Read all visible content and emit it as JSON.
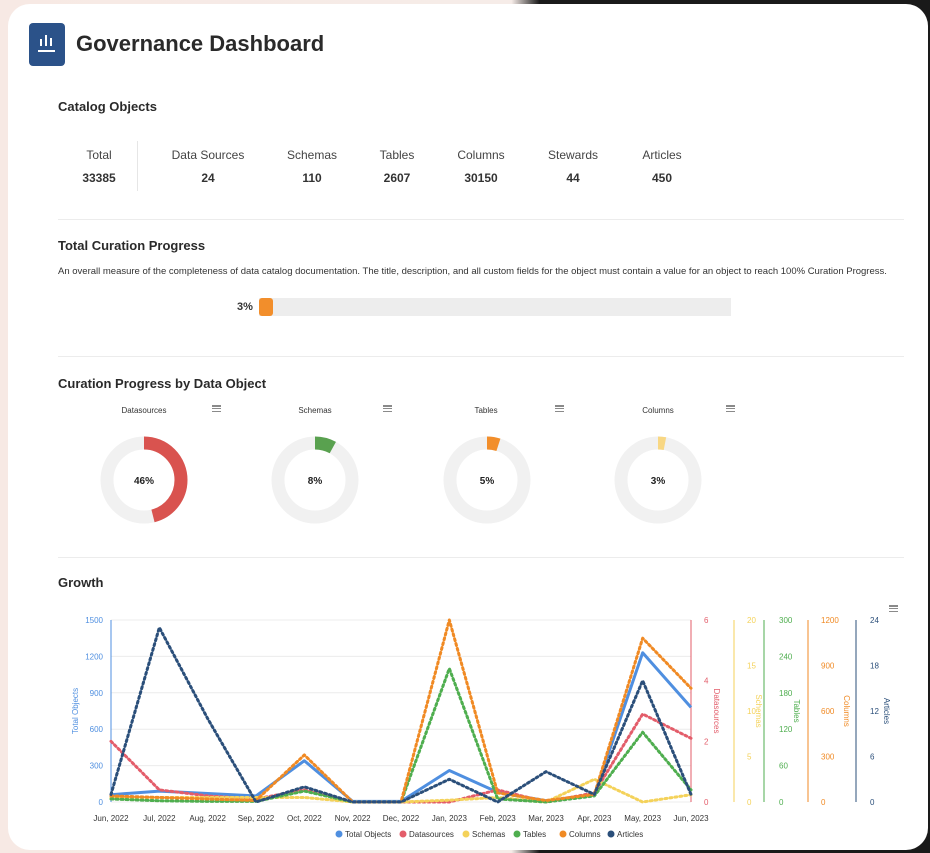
{
  "header": {
    "title": "Governance Dashboard",
    "logo_icon": "bar-chart-icon",
    "logo_color": "#2b5289"
  },
  "catalog": {
    "heading": "Catalog Objects",
    "stats": [
      {
        "label": "Total",
        "value": "33385"
      },
      {
        "label": "Data Sources",
        "value": "24"
      },
      {
        "label": "Schemas",
        "value": "110"
      },
      {
        "label": "Tables",
        "value": "2607"
      },
      {
        "label": "Columns",
        "value": "30150"
      },
      {
        "label": "Stewards",
        "value": "44"
      },
      {
        "label": "Articles",
        "value": "450"
      }
    ]
  },
  "curation": {
    "heading": "Total Curation Progress",
    "description": "An overall measure of the completeness of data catalog documentation. The title, description, and all custom fields for the object must contain a value for an object to reach 100% Curation Progress.",
    "percent_label": "3%",
    "percent_value": 3,
    "bar_color": "#f28e2b"
  },
  "by_object": {
    "heading": "Curation Progress by Data Object",
    "donuts": [
      {
        "title": "Datasources",
        "label": "46%",
        "value": 46,
        "color": "#d9534f"
      },
      {
        "title": "Schemas",
        "label": "8%",
        "value": 8,
        "color": "#59a14f"
      },
      {
        "title": "Tables",
        "label": "5%",
        "value": 5,
        "color": "#f28e2b"
      },
      {
        "title": "Columns",
        "label": "3%",
        "value": 3,
        "color": "#f8d783"
      }
    ]
  },
  "growth": {
    "heading": "Growth"
  },
  "chart_data": {
    "type": "line",
    "x": [
      "Jun, 2022",
      "Jul, 2022",
      "Aug, 2022",
      "Sep, 2022",
      "Oct, 2022",
      "Nov, 2022",
      "Dec, 2022",
      "Jan, 2023",
      "Feb, 2023",
      "Mar, 2023",
      "Apr, 2023",
      "May, 2023",
      "Jun, 2023"
    ],
    "axes": [
      {
        "key": "total",
        "title": "Total Objects",
        "ticks": [
          "0",
          "300",
          "600",
          "900",
          "1200",
          "1500"
        ],
        "max": 1500,
        "color": "#4f8fe0",
        "side": "left"
      },
      {
        "key": "ds",
        "title": "Datasources",
        "ticks": [
          "0",
          "2",
          "4",
          "6"
        ],
        "max": 6,
        "color": "#e35d6a",
        "side": "right"
      },
      {
        "key": "sc",
        "title": "Schemas",
        "ticks": [
          "0",
          "5",
          "10",
          "15",
          "20"
        ],
        "max": 20,
        "color": "#f4d25a",
        "side": "right"
      },
      {
        "key": "tb",
        "title": "Tables",
        "ticks": [
          "0",
          "60",
          "120",
          "180",
          "240",
          "300"
        ],
        "max": 300,
        "color": "#4fae4f",
        "side": "right"
      },
      {
        "key": "co",
        "title": "Columns",
        "ticks": [
          "0",
          "300",
          "600",
          "900",
          "1200"
        ],
        "max": 1200,
        "color": "#f08a24",
        "side": "right"
      },
      {
        "key": "ar",
        "title": "Articles",
        "ticks": [
          "0",
          "6",
          "12",
          "18",
          "24"
        ],
        "max": 24,
        "color": "#2b4f7a",
        "side": "right"
      }
    ],
    "series": [
      {
        "name": "Total Objects",
        "axis": "total",
        "dashed": false,
        "color": "#4f8fe0",
        "values": [
          60,
          90,
          70,
          50,
          340,
          5,
          5,
          260,
          80,
          10,
          60,
          1230,
          780
        ]
      },
      {
        "name": "Datasources",
        "axis": "ds",
        "dashed": true,
        "color": "#e35d6a",
        "values": [
          2,
          0.4,
          0.2,
          0.1,
          0.4,
          0,
          0,
          0,
          0.4,
          0,
          0.3,
          2.9,
          2.1
        ]
      },
      {
        "name": "Schemas",
        "axis": "sc",
        "dashed": true,
        "color": "#f4d25a",
        "values": [
          0.5,
          0.5,
          0.5,
          0.5,
          0.5,
          0,
          0,
          0.2,
          0.5,
          0,
          2.5,
          0,
          0.8
        ]
      },
      {
        "name": "Tables",
        "axis": "tb",
        "dashed": true,
        "color": "#4fae4f",
        "values": [
          5,
          2,
          1,
          1,
          18,
          0,
          0,
          220,
          5,
          0,
          10,
          115,
          20
        ]
      },
      {
        "name": "Columns",
        "axis": "co",
        "dashed": true,
        "color": "#f08a24",
        "values": [
          40,
          30,
          20,
          10,
          310,
          0,
          0,
          1200,
          60,
          10,
          50,
          1080,
          750
        ]
      },
      {
        "name": "Articles",
        "axis": "ar",
        "dashed": true,
        "color": "#2b4f7a",
        "values": [
          1,
          23,
          11,
          0,
          2,
          0,
          0,
          3,
          0,
          4,
          1,
          16,
          1
        ]
      }
    ],
    "legend": "bottom",
    "grid": true
  }
}
